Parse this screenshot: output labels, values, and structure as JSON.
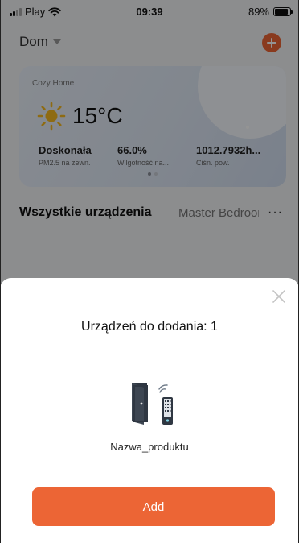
{
  "status_bar": {
    "carrier": "Play",
    "time": "09:39",
    "battery": "89%",
    "battery_level": 0.89
  },
  "header": {
    "home_name": "Dom"
  },
  "weather": {
    "card_title": "Cozy Home",
    "temperature": "15°C",
    "metrics": [
      {
        "value": "Doskonała",
        "label": "PM2.5 na zewn."
      },
      {
        "value": "66.0%",
        "label": "Wilgotność na..."
      },
      {
        "value": "1012.7932h...",
        "label": "Ciśn. pow."
      }
    ]
  },
  "devices": {
    "title": "Wszystkie urządzenia",
    "room_tab": "Master Bedroom",
    "more": "···"
  },
  "sheet": {
    "title": "Urządzeń do dodania: 1",
    "product_name": "Nazwa_produktu",
    "add_label": "Add"
  },
  "colors": {
    "accent": "#ec6535",
    "overlay": "rgba(0,0,0,0.42)"
  }
}
